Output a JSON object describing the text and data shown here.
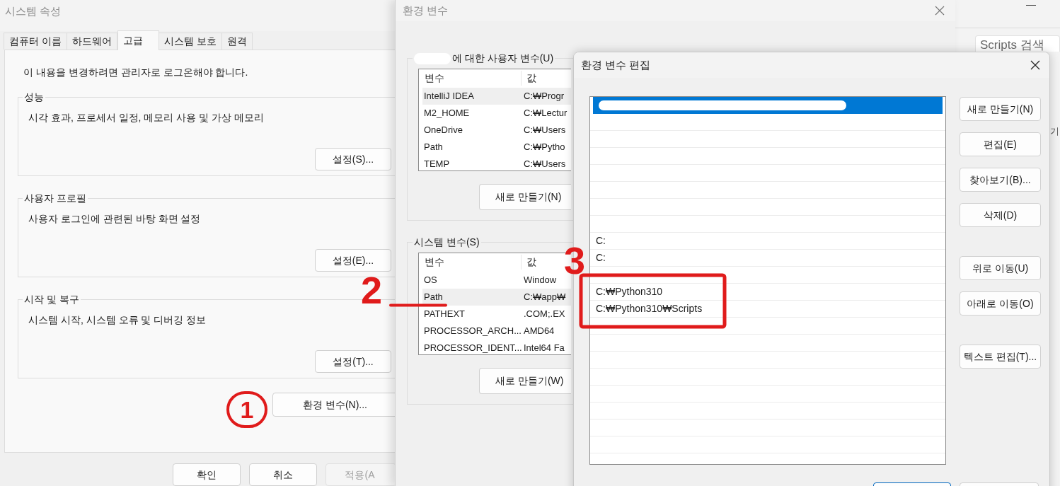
{
  "system_properties": {
    "title": "시스템 속성",
    "tabs": [
      {
        "label": "컴퓨터 이름",
        "selected": false
      },
      {
        "label": "하드웨어",
        "selected": false
      },
      {
        "label": "고급",
        "selected": true
      },
      {
        "label": "시스템 보호",
        "selected": false
      },
      {
        "label": "원격",
        "selected": false
      }
    ],
    "notice": "이 내용을 변경하려면 관리자로 로그온해야 합니다.",
    "groups": [
      {
        "title": "성능",
        "description": "시각 효과, 프로세서 일정, 메모리 사용 및 가상 메모리",
        "button": "설정(S)..."
      },
      {
        "title": "사용자 프로필",
        "description": "사용자 로그인에 관련된 바탕 화면 설정",
        "button": "설정(E)..."
      },
      {
        "title": "시작 및 복구",
        "description": "시스템 시작, 시스템 오류 및 디버깅 정보",
        "button": "설정(T)..."
      }
    ],
    "env_button": "환경 변수(N)...",
    "buttons": [
      {
        "label": "확인",
        "disabled": false
      },
      {
        "label": "취소",
        "disabled": false
      },
      {
        "label": "적용(A",
        "disabled": true
      }
    ]
  },
  "environment_variables": {
    "title": "환경 변수",
    "user_section": {
      "title": "에 대한 사용자 변수(U)",
      "columns": [
        "변수",
        "값"
      ],
      "rows": [
        {
          "name": "IntelliJ IDEA",
          "value": "C:₩Progr",
          "selected": true
        },
        {
          "name": "M2_HOME",
          "value": "C:₩Lectur",
          "selected": false
        },
        {
          "name": "OneDrive",
          "value": "C:₩Users",
          "selected": false
        },
        {
          "name": "Path",
          "value": "C:₩Pytho",
          "selected": false
        },
        {
          "name": "TEMP",
          "value": "C:₩Users",
          "selected": false
        }
      ],
      "button": "새로 만들기(N)"
    },
    "system_section": {
      "title": "시스템 변수(S)",
      "columns": [
        "변수",
        "값"
      ],
      "rows": [
        {
          "name": "OS",
          "value": "Window",
          "selected": false
        },
        {
          "name": "Path",
          "value": "C:₩app₩",
          "selected": true
        },
        {
          "name": "PATHEXT",
          "value": ".COM;.EX",
          "selected": false
        },
        {
          "name": "PROCESSOR_ARCH...",
          "value": "AMD64",
          "selected": false
        },
        {
          "name": "PROCESSOR_IDENT...",
          "value": "Intel64 Fa",
          "selected": false
        }
      ],
      "button": "새로 만들기(W)"
    }
  },
  "edit_dialog": {
    "title": "환경 변수 편집",
    "entries": [
      {
        "selected": true,
        "redacted": true
      },
      {
        "selected": false
      },
      {
        "selected": false
      },
      {
        "selected": false
      },
      {
        "selected": false
      },
      {
        "selected": false
      },
      {
        "selected": false
      },
      {
        "selected": false
      },
      {
        "text": "C:",
        "selected": false
      },
      {
        "text": "C:",
        "selected": false
      },
      {
        "selected": false
      },
      {
        "text": "C:₩Python310",
        "selected": false
      },
      {
        "text": "C:₩Python310₩Scripts",
        "selected": false
      }
    ],
    "button_groups": [
      [
        "새로 만들기(N)",
        "편집(E)",
        "찾아보기(B)...",
        "삭제(D)"
      ],
      [
        "위로 이동(U)",
        "아래로 이동(O)"
      ],
      [
        "텍스트 편집(T)..."
      ]
    ]
  },
  "background_window": {
    "search_placeholder": "Scripts 검색",
    "cut_text": "기"
  },
  "annotations": [
    {
      "text": "1"
    },
    {
      "text": "2"
    },
    {
      "text": "3"
    }
  ]
}
